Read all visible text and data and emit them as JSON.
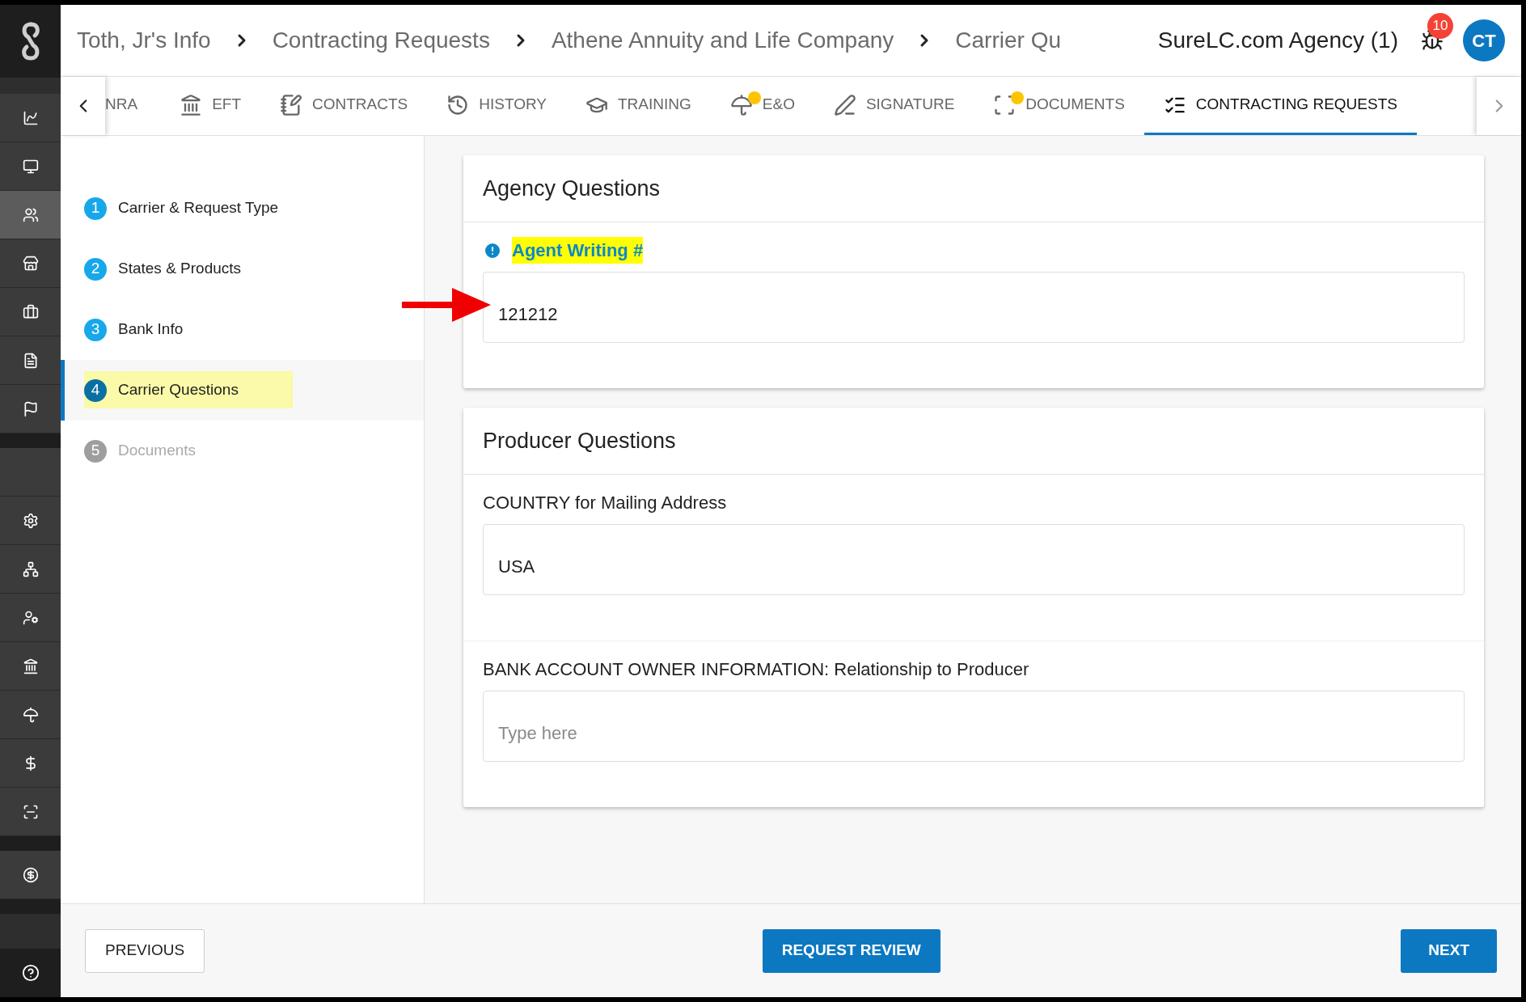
{
  "sidebar": {
    "items": [
      {
        "selected": false
      },
      {
        "selected": false
      },
      {
        "selected": true
      },
      {
        "selected": false
      },
      {
        "selected": false
      },
      {
        "selected": false
      },
      {
        "selected": false
      },
      {
        "selected": false
      },
      {
        "selected": false
      },
      {
        "selected": false
      },
      {
        "selected": false
      },
      {
        "selected": false
      },
      {
        "selected": false
      },
      {
        "selected": false
      },
      {
        "selected": false
      },
      {
        "selected": false
      }
    ]
  },
  "breadcrumbs": [
    "Toth, Jr's Info",
    "Contracting Requests",
    "Athene Annuity and Life Company",
    "Carrier Qu"
  ],
  "agency": "SureLC.com Agency (1)",
  "notification_count": "10",
  "avatar": "CT",
  "tabs": [
    {
      "label": "NRA",
      "selected": false,
      "alert": false
    },
    {
      "label": "EFT",
      "selected": false,
      "alert": false
    },
    {
      "label": "CONTRACTS",
      "selected": false,
      "alert": false
    },
    {
      "label": "HISTORY",
      "selected": false,
      "alert": false
    },
    {
      "label": "TRAINING",
      "selected": false,
      "alert": false
    },
    {
      "label": "E&O",
      "selected": false,
      "alert": true
    },
    {
      "label": "SIGNATURE",
      "selected": false,
      "alert": false
    },
    {
      "label": "DOCUMENTS",
      "selected": false,
      "alert": true
    },
    {
      "label": "CONTRACTING REQUESTS",
      "selected": true,
      "alert": false
    }
  ],
  "steps": [
    {
      "number": "1",
      "label": "Carrier & Request Type",
      "selected": false,
      "disabled": false,
      "highlighted": false
    },
    {
      "number": "2",
      "label": "States & Products",
      "selected": false,
      "disabled": false,
      "highlighted": false
    },
    {
      "number": "3",
      "label": "Bank Info",
      "selected": false,
      "disabled": false,
      "highlighted": false
    },
    {
      "number": "4",
      "label": "Carrier Questions",
      "selected": true,
      "disabled": false,
      "highlighted": true
    },
    {
      "number": "5",
      "label": "Documents",
      "selected": false,
      "disabled": true,
      "highlighted": false
    }
  ],
  "sections": [
    {
      "title": "Agency Questions",
      "questions": [
        {
          "label": "Agent Writing #",
          "required": true,
          "highlighted": true,
          "value": "121212",
          "pointed": true
        }
      ]
    },
    {
      "title": "Producer Questions",
      "questions": [
        {
          "label": "COUNTRY for Mailing Address",
          "required": false,
          "highlighted": false,
          "value": "USA",
          "pointed": false
        },
        {
          "label": "BANK ACCOUNT OWNER INFORMATION: Relationship to Producer",
          "required": false,
          "highlighted": false,
          "placeholder": "Type here",
          "pointed": false
        }
      ]
    }
  ],
  "footer": {
    "previous": "PREVIOUS",
    "review": "REQUEST REVIEW",
    "next": "NEXT"
  }
}
